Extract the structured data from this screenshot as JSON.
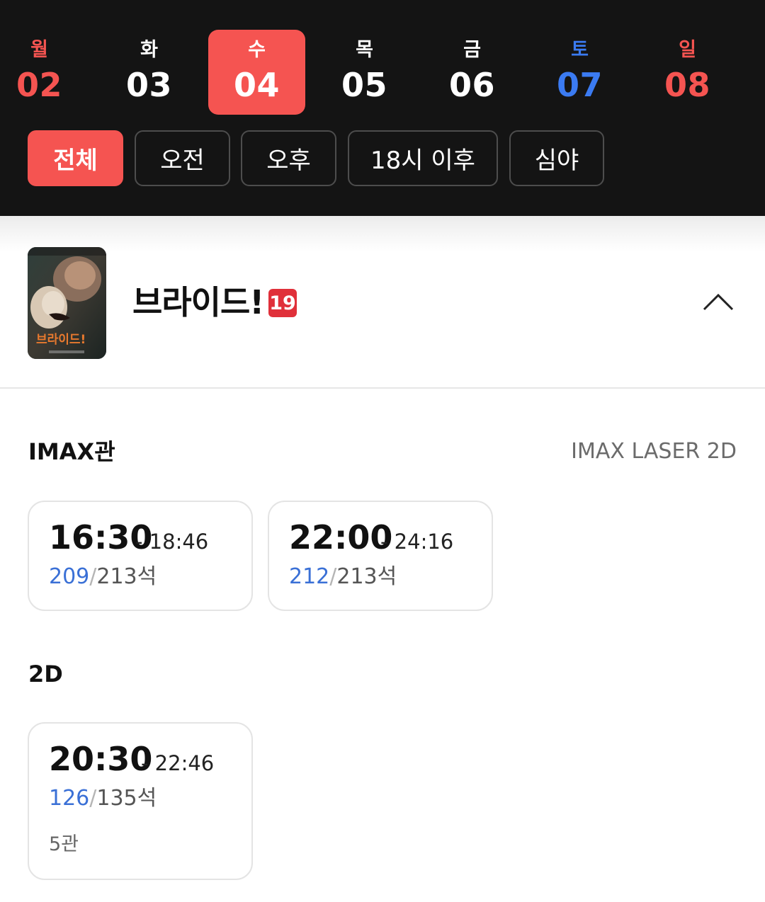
{
  "dates": [
    {
      "weekday": "월",
      "day": "02",
      "type": "sun"
    },
    {
      "weekday": "화",
      "day": "03",
      "type": "normal"
    },
    {
      "weekday": "수",
      "day": "04",
      "type": "selected"
    },
    {
      "weekday": "목",
      "day": "05",
      "type": "normal"
    },
    {
      "weekday": "금",
      "day": "06",
      "type": "normal"
    },
    {
      "weekday": "토",
      "day": "07",
      "type": "sat"
    },
    {
      "weekday": "일",
      "day": "08",
      "type": "sun"
    }
  ],
  "filters": [
    "전체",
    "오전",
    "오후",
    "18시 이후",
    "심야"
  ],
  "movie": {
    "title": "브라이드!",
    "rating": "19",
    "poster_title": "브라이드!"
  },
  "sections": [
    {
      "title": "IMAX관",
      "meta": "IMAX LASER 2D",
      "showtimes": [
        {
          "start": "16:30",
          "end": "- 18:46",
          "available": "209",
          "total": "213석"
        },
        {
          "start": "22:00",
          "end": "- 24:16",
          "available": "212",
          "total": "213석"
        }
      ]
    },
    {
      "title": "2D",
      "meta": "",
      "showtimes": [
        {
          "start": "20:30",
          "end": "- 22:46",
          "available": "126",
          "total": "135석",
          "hall": "5관"
        }
      ]
    }
  ],
  "colors": {
    "accent": "#f55451",
    "saturday": "#3b7bf2",
    "available_seats": "#3a70d6",
    "header_bg": "#141414"
  }
}
